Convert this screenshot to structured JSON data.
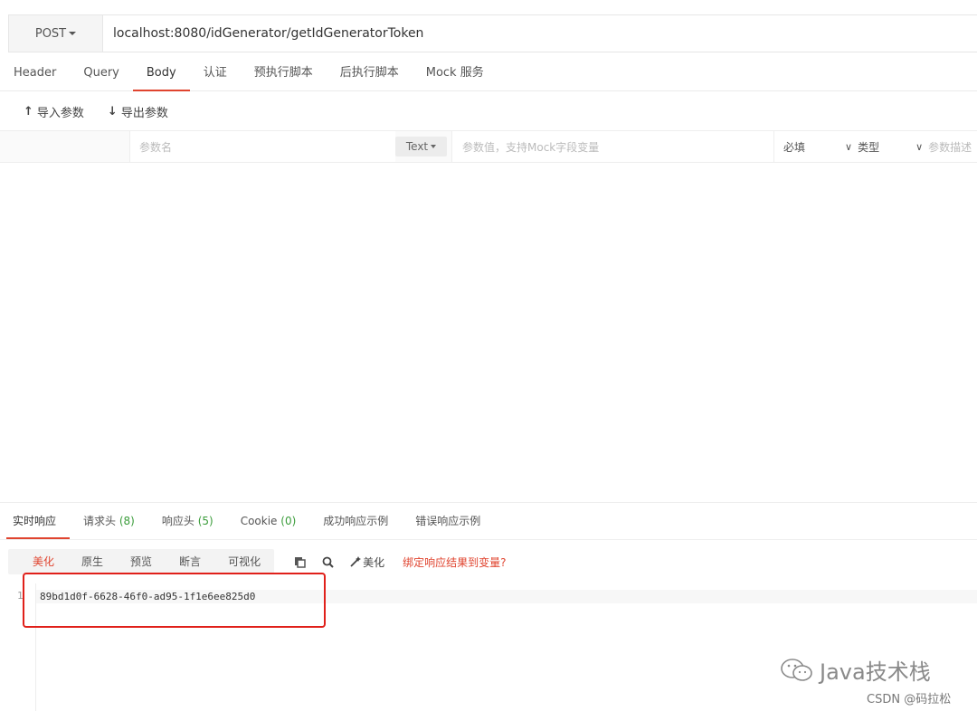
{
  "request": {
    "method": "POST",
    "url": "localhost:8080/idGenerator/getIdGeneratorToken"
  },
  "request_tabs": [
    {
      "label": "Header"
    },
    {
      "label": "Query"
    },
    {
      "label": "Body"
    },
    {
      "label": "认证"
    },
    {
      "label": "预执行脚本"
    },
    {
      "label": "后执行脚本"
    },
    {
      "label": "Mock 服务"
    }
  ],
  "io": {
    "import_label": "导入参数",
    "export_label": "导出参数"
  },
  "params_header": {
    "name_placeholder": "参数名",
    "type_value": "Text",
    "value_placeholder": "参数值，支持Mock字段变量",
    "required_label": "必填",
    "type_label": "类型",
    "desc_placeholder": "参数描述"
  },
  "response_tabs": [
    {
      "label": "实时响应",
      "count": ""
    },
    {
      "label": "请求头",
      "count": "(8)"
    },
    {
      "label": "响应头",
      "count": "(5)"
    },
    {
      "label": "Cookie",
      "count": "(0)"
    },
    {
      "label": "成功响应示例",
      "count": ""
    },
    {
      "label": "错误响应示例",
      "count": ""
    }
  ],
  "format_buttons": [
    {
      "label": "美化"
    },
    {
      "label": "原生"
    },
    {
      "label": "预览"
    },
    {
      "label": "断言"
    },
    {
      "label": "可视化"
    }
  ],
  "tools": {
    "beautify_label": "美化",
    "bind_link": "绑定响应结果到变量?"
  },
  "response_body": {
    "line_number": "1",
    "content": "89bd1d0f-6628-46f0-ad95-1f1e6ee825d0"
  },
  "watermark": {
    "text": "Java技术栈",
    "csdn": "CSDN @码拉松"
  },
  "colors": {
    "accent": "#e0442f",
    "highlight_box": "#e0201a",
    "count_green": "#3a9c3a"
  }
}
